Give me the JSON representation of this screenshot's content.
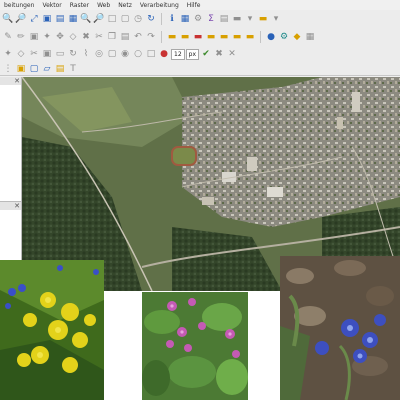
{
  "menubar": {
    "items": [
      "beitungen",
      "Vektor",
      "Raster",
      "Web",
      "Netz",
      "Verarbeitung",
      "Hilfe"
    ]
  },
  "toolbar2": {
    "spin_value": "12",
    "unit_value": "px"
  },
  "icons": {
    "toolbar1": [
      "zoom-in-icon",
      "zoom-out-icon",
      "zoom-full-icon",
      "zoom-selection-icon",
      "zoom-layer-icon",
      "zoom-last-icon",
      "zoom-next-icon",
      "new-map-view-icon",
      "temporal-controller-icon",
      "refresh-icon",
      "identify-icon",
      "open-attribute-table-icon",
      "settings-icon",
      "sum-statistics-icon",
      "field-calculator-icon",
      "measure-icon",
      "annotation-icon",
      "map-tips-icon"
    ],
    "toolbar2": [
      "digitize-icon",
      "edit-icon",
      "add-feature-icon",
      "move-feature-icon",
      "node-tool-icon",
      "delete-icon",
      "cut-icon",
      "copy-icon",
      "paste-icon",
      "undo-icon",
      "redo-icon",
      "label-icon",
      "pin-label-icon",
      "show-label-icon",
      "rotate-label-icon",
      "change-label-icon",
      "python-icon",
      "plugin-icon"
    ],
    "toolbar4": [
      "select-feature-icon",
      "select-rectangle-icon",
      "select-polygon-icon",
      "deselect-icon",
      "text-annotation-icon"
    ]
  },
  "map": {
    "description_colors": [
      "#4a5a3a",
      "#6a7a55",
      "#8f8f82",
      "#b9b7ae",
      "#3d5a2e",
      "#a9a191"
    ]
  },
  "photos": [
    {
      "subject": "yellow-flowers-blue-flowers"
    },
    {
      "subject": "purple-primrose-flowers"
    },
    {
      "subject": "blue-scilla-flowers-on-leaf-litter"
    }
  ]
}
